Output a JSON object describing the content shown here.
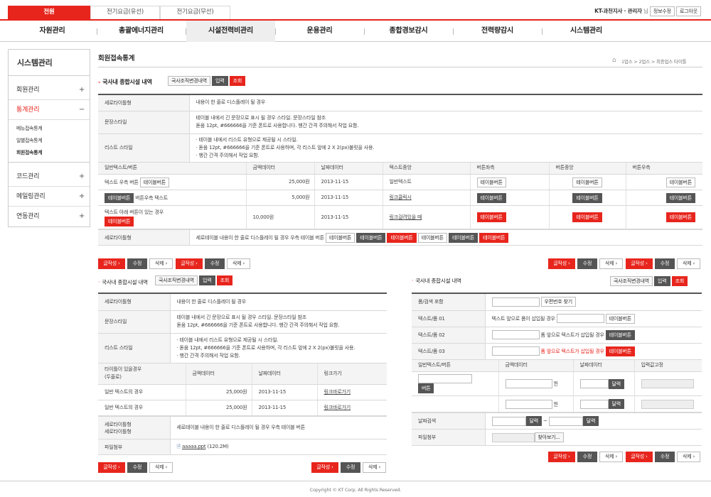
{
  "top_tabs": [
    "전원",
    "전기요금(유선)",
    "전기요금(무선)"
  ],
  "user": {
    "name": "KT-과천지사 · 관리자",
    "honorific": "님",
    "edit": "정보수정",
    "logout": "로그아웃"
  },
  "gnb": [
    "자원관리",
    "총괄에너지관리",
    "시설전력비관리",
    "운용관리",
    "종합경보감시",
    "전력량감시",
    "시스템관리"
  ],
  "sidebar": {
    "title": "시스템관리",
    "items": [
      {
        "label": "회원관리",
        "mark": "+"
      },
      {
        "label": "통계관리",
        "mark": "−",
        "sub": [
          "메뉴접속통계",
          "일별접속통계",
          "회원접속통계"
        ]
      },
      {
        "label": "코드관리",
        "mark": "+"
      },
      {
        "label": "메일링관리",
        "mark": "+"
      },
      {
        "label": "연동관리",
        "mark": "+"
      }
    ]
  },
  "page": {
    "title": "회원접속통계",
    "breadcrumb": "1업스 > 2업스 > 최종업스 타이틀"
  },
  "sec1": {
    "title": "국사내 종합시설 내역",
    "btn_change": "국사조직변경내역",
    "btn_input": "입력",
    "btn_search": "조회",
    "row1_th": "세로타이틀형",
    "row1_td": "내용이 한 줄로 디스플레이 될 경우",
    "row2_th": "문장스타일",
    "row2_l1": "테이블 내에서 긴 문장으로 표시 될 경우 스타일. 문장스타일 참조",
    "row2_l2": "돋움 12pt, #666666을 기준 폰트로 사용합니다. 행간 간격 주의해서 작업 요함.",
    "row3_th": "리스트 스타일",
    "row3_l1": "· 테이블 내에서 리스트 유형으로 제공될 시 스타일.",
    "row3_l2": "· 돋움 12pt, #666666을 기준 폰트로 사용하며, 각 리스트 앞에 2 X 2(px)불릿을 사용.",
    "row3_l3": "· 행간 간격 주의해서 작업 요함.",
    "headers": [
      "일반텍스트/버튼",
      "금액데이터",
      "날짜데이터",
      "텍스트중앙",
      "버튼좌측",
      "버튼중앙",
      "버튼우측"
    ],
    "r1": {
      "text": "텍스트 우측 버튼",
      "btn": "테이블버튼",
      "amount": "25,000원",
      "date": "2013-11-15",
      "center": "일반텍스트"
    },
    "r2": {
      "btn": "테이블버튼",
      "text": "버튼우측 텍스트",
      "amount": "5,000원",
      "date": "2013-11-15",
      "center": "링크클릭시"
    },
    "r3": {
      "text": "텍스트 아래 버튼이 있는 경우",
      "btn": "테이블버튼",
      "amount": "10,000원",
      "date": "2013-11-15",
      "center": "링크걸려있을 때"
    },
    "tbtn": "테이블버튼",
    "last_th": "세로타이틀형",
    "last_td": "세로테이블 내용이 한 줄로 디스플레이 될 경우 우측 테이블 버튼"
  },
  "actions": {
    "write": "글작성 ›",
    "edit": "수정",
    "delete": "삭제 ›"
  },
  "sec2": {
    "title": "국사내 종합시설 내역",
    "btn_change": "국사조직변경내역",
    "btn_input": "입력",
    "btn_search": "조회",
    "row1_th": "세로타이틀형",
    "row1_td": "내용이 한 줄로 디스플레이 될 경우",
    "row2_th": "문장스타일",
    "row2_l1": "테이블 내에서 긴 문장으로 표시 될 경우 스타일. 문장스타일 참조",
    "row2_l2": "돋움 12pt, #666666을 기준 폰트로 사용합니다. 행간 간격 주의해서 작업 요함.",
    "row3_th": "리스트 스타일",
    "row3_l1": "· 테이블 내에서 리스트 유형으로 제공될 시 스타일.",
    "row3_l2": "· 돋움 12pt, #666666을 기준 폰트로 사용하며, 각 리스트 앞에 2 X 2(px)불릿을 사용.",
    "row3_l3": "· 행간 간격 주의해서 작업 요함.",
    "h_title1": "타이틀이 있을경우",
    "h_title2": "(두줄로)",
    "h_amount": "금액데이터",
    "h_date": "날짜데이터",
    "h_link": "링크가기",
    "rows": [
      {
        "text": "일반 텍스트의 경우",
        "amount": "25,000원",
        "date": "2013-11-15",
        "link": "링크바로가기"
      },
      {
        "text": "일반 텍스트의 경우",
        "amount": "25,000원",
        "date": "2013-11-15",
        "link": "링크바로가기"
      }
    ],
    "last_th1": "세로타이틀형",
    "last_th2": "세로타이틀형",
    "last_td": "세로테이블 내용이 한 줄로 디스플레이 될 경우 우측 테이블 버튼",
    "file_th": "파일첨부",
    "file_name": "aaaaa.ppt",
    "file_size": "(120.2M)"
  },
  "sec3": {
    "title": "국사내 종합시설 내역",
    "btn_change": "국사조직변경내역",
    "btn_input": "입력",
    "btn_search": "조회",
    "f1_th": "폼/검색 포함",
    "f1_btn": "우편번호 찾기",
    "f2_th": "텍스트/폼 01",
    "f2_text": "텍스트 앞으로 폼이 삽입될 경우",
    "f2_btn": "테이블버튼",
    "f3_th": "텍스트/폼 02",
    "f3_text": "폼 앞으로 텍스트가 삽입될 경우",
    "f3_btn": "테이블버튼",
    "f4_th": "텍스트/폼 03",
    "f4_text": "폼 앞으로 텍스트가 삽입될 경우",
    "f4_btn": "테이블버튼",
    "headers": [
      "일반텍스트/버튼",
      "금액데이터",
      "날짜데이터",
      "입력값고정"
    ],
    "btn": "버튼",
    "won": "원",
    "cal": "달력",
    "date_th": "날짜검색",
    "tilde": "~",
    "file_th": "파일첨부",
    "file_btn": "찾아보기..."
  },
  "footer": "Copyright © KT Corp. All Rights Reserved."
}
